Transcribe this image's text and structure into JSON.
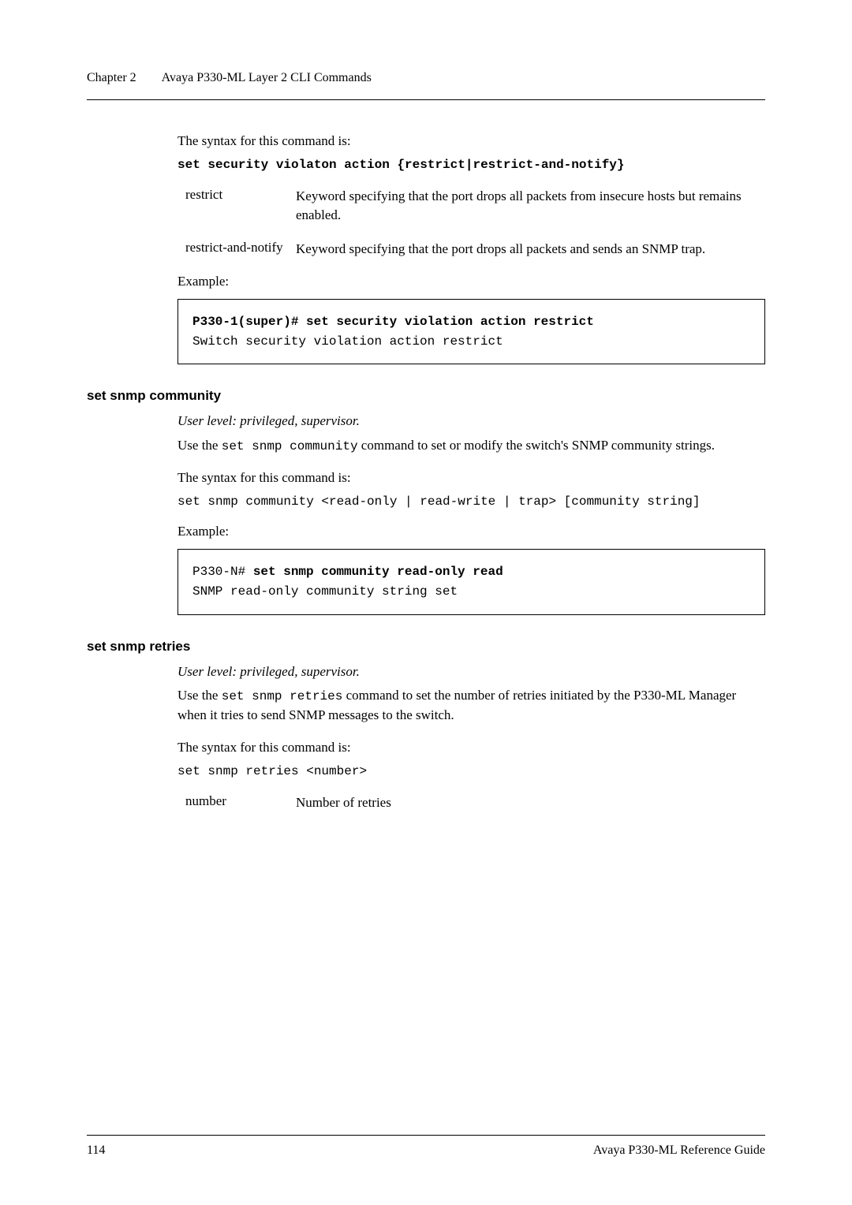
{
  "header": {
    "chapter": "Chapter 2",
    "title": "Avaya P330-ML Layer 2 CLI Commands"
  },
  "intro": {
    "syntax_intro": "The syntax for this command is:",
    "syntax_line": "set security violaton action {restrict|restrict-and-notify}",
    "params": [
      {
        "name": "restrict",
        "desc": "Keyword specifying that the port drops all packets from insecure hosts but remains enabled."
      },
      {
        "name": "restrict-and-notify",
        "desc": "Keyword specifying that the port drops all packets and sends an SNMP trap."
      }
    ],
    "example_label": "Example:",
    "code": [
      {
        "text": "P330-1(super)# set security violation action restrict",
        "bold": true
      },
      {
        "text": "Switch security violation action restrict",
        "bold": false
      }
    ]
  },
  "sec_community": {
    "heading": "set snmp community",
    "userlevel": "User level: privileged, supervisor.",
    "desc_pre": "Use the ",
    "desc_cmd": "set snmp community",
    "desc_post": " command to set or modify the switch's SNMP community strings.",
    "syntax_intro": "The syntax for this command is:",
    "syntax_line": "set snmp community <read-only | read-write | trap> [community string]",
    "example_label": "Example:",
    "code": [
      {
        "text": "P330-N# ",
        "bold": false,
        "inline": true
      },
      {
        "text": "set snmp community read-only read",
        "bold": true,
        "inline": true
      },
      {
        "text": "SNMP read-only community string set",
        "bold": false,
        "inline": false
      }
    ]
  },
  "sec_retries": {
    "heading": "set snmp retries",
    "userlevel": "User level: privileged, supervisor.",
    "desc_pre": "Use the ",
    "desc_cmd": "set snmp retries",
    "desc_post": " command to set the number of retries initiated by the P330-ML Manager when it tries to send SNMP messages to the switch.",
    "syntax_intro": "The syntax for this command is:",
    "syntax_line": "set snmp retries <number>",
    "params": [
      {
        "name": "number",
        "desc": "Number of retries"
      }
    ]
  },
  "footer": {
    "page": "114",
    "guide": "Avaya P330-ML Reference Guide"
  }
}
